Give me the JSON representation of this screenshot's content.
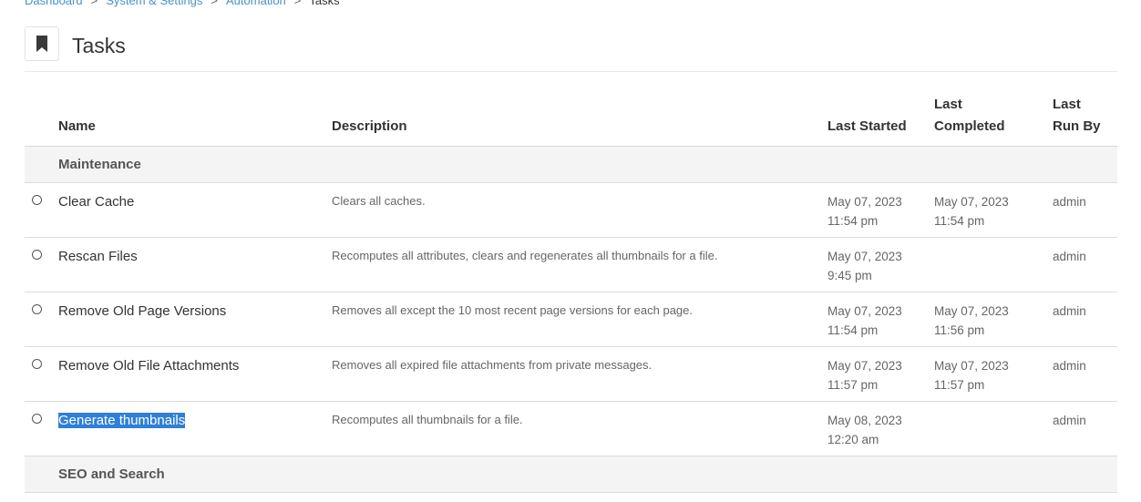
{
  "breadcrumb": {
    "items": [
      "Dashboard",
      "System & Settings",
      "Automation"
    ],
    "separator": ">",
    "current": "Tasks"
  },
  "header": {
    "icon": "bookmark-icon",
    "title": "Tasks"
  },
  "table": {
    "columns": {
      "name": "Name",
      "description": "Description",
      "last_started": "Last Started",
      "last_completed_1": "Last",
      "last_completed_2": "Completed",
      "last_run_by_1": "Last",
      "last_run_by_2": "Run By"
    },
    "groups": [
      {
        "title": "Maintenance",
        "tasks": [
          {
            "name": "Clear Cache",
            "description": "Clears all caches.",
            "started_date": "May 07, 2023",
            "started_time": "11:54 pm",
            "completed_date": "May 07, 2023",
            "completed_time": "11:54 pm",
            "run_by": "admin"
          },
          {
            "name": "Rescan Files",
            "description": "Recomputes all attributes, clears and regenerates all thumbnails for a file.",
            "started_date": "May 07, 2023",
            "started_time": "9:45 pm",
            "completed_date": "",
            "completed_time": "",
            "run_by": "admin"
          },
          {
            "name": "Remove Old Page Versions",
            "description": "Removes all except the 10 most recent page versions for each page.",
            "started_date": "May 07, 2023",
            "started_time": "11:54 pm",
            "completed_date": "May 07, 2023",
            "completed_time": "11:56 pm",
            "run_by": "admin"
          },
          {
            "name": "Remove Old File Attachments",
            "description": "Removes all expired file attachments from private messages.",
            "started_date": "May 07, 2023",
            "started_time": "11:57 pm",
            "completed_date": "May 07, 2023",
            "completed_time": "11:57 pm",
            "run_by": "admin"
          },
          {
            "name": "Generate thumbnails",
            "description": "Recomputes all thumbnails for a file.",
            "started_date": "May 08, 2023",
            "started_time": "12:20 am",
            "completed_date": "",
            "completed_time": "",
            "run_by": "admin"
          }
        ]
      },
      {
        "title": "SEO and Search",
        "tasks": []
      }
    ]
  },
  "colors": {
    "link": "#4a90c8",
    "selection": "#2f7fd8",
    "group_bg": "#f4f4f4"
  }
}
